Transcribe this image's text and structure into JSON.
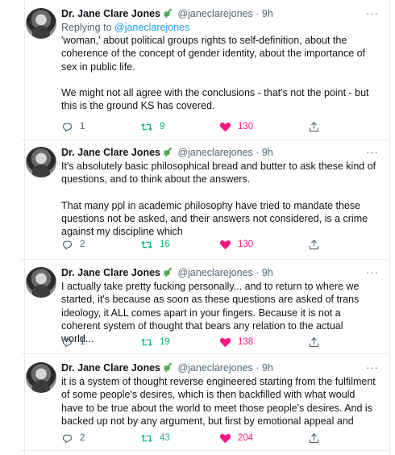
{
  "tweets": [
    {
      "name": "Dr. Jane Clare Jones",
      "handle": "@janeclarejones",
      "dot": "·",
      "time": "9h",
      "more": "···",
      "replying_prefix": "Replying to ",
      "replying_to": "@janeclarejones",
      "body": "'woman,' about political groups rights to self-definition, about the coherence of the concept of gender identity, about the importance of sex in public life.\n\nWe might not all agree with the conclusions - that's not the point - but this is the ground KS has covered.",
      "replies": "1",
      "retweets": "9",
      "likes": "130"
    },
    {
      "name": "Dr. Jane Clare Jones",
      "handle": "@janeclarejones",
      "dot": "·",
      "time": "9h",
      "more": "···",
      "body": "It's absolutely basic philosophical bread and butter to ask these kind of questions, and to think about the answers.\n\nThat many ppl in academic philosophy have tried to mandate these questions not be asked, and their answers not considered, is a crime against my discipline which",
      "replies": "2",
      "retweets": "16",
      "likes": "130"
    },
    {
      "name": "Dr. Jane Clare Jones",
      "handle": "@janeclarejones",
      "dot": "·",
      "time": "9h",
      "more": "···",
      "body": "I actually take pretty fucking personally... and to return to where we started, it's because as soon as these questions are asked of trans ideology, it ALL comes apart in your fingers. Because it is not a coherent system of thought that bears any relation to the actual world...",
      "replies": "1",
      "retweets": "19",
      "likes": "138"
    },
    {
      "name": "Dr. Jane Clare Jones",
      "handle": "@janeclarejones",
      "dot": "·",
      "time": "9h",
      "more": "···",
      "body": "it is a system of thought reverse engineered starting from the fulfilment of some people's desires, which is then backfilled with what would have to be true about the world to meet those people's desires. And is backed up not by any argument, but first by emotional appeal and",
      "replies": "2",
      "retweets": "43",
      "likes": "204"
    }
  ],
  "icons": {
    "name_emoji": "dinosaur-icon",
    "reply": "reply-icon",
    "retweet": "retweet-icon",
    "like": "heart-icon",
    "share": "share-icon"
  },
  "colors": {
    "text": "#0f1419",
    "muted": "#536471",
    "link": "#1d9bf0",
    "retweet": "#00ba7c",
    "like": "#f91880"
  }
}
